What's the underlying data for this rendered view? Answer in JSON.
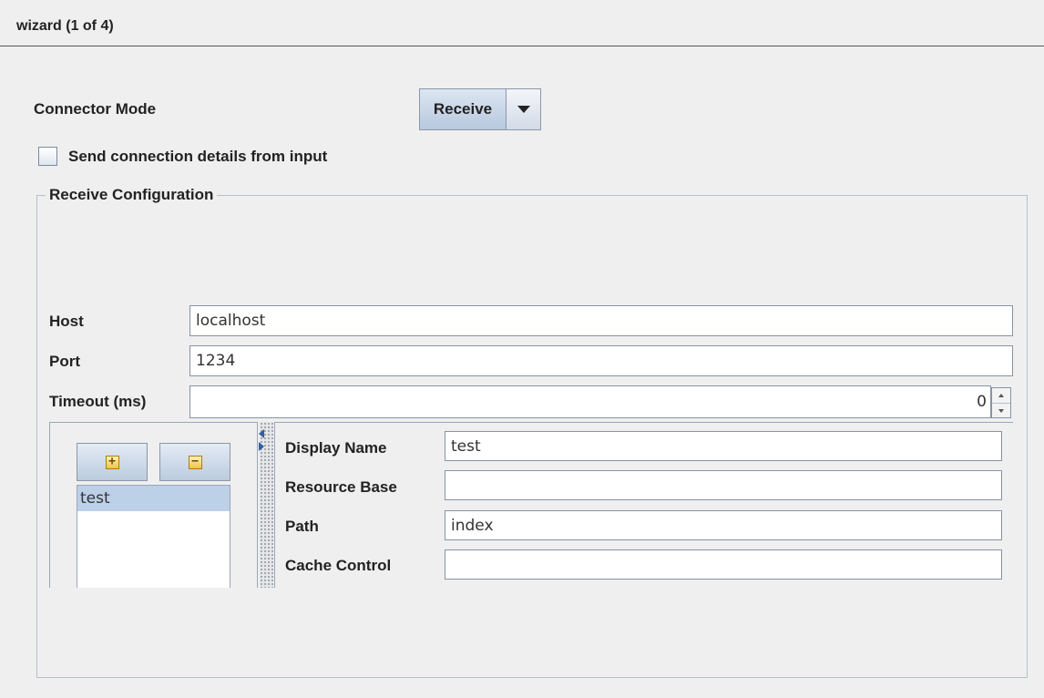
{
  "window": {
    "title": "wizard (1 of 4)"
  },
  "connector_mode": {
    "label": "Connector Mode",
    "selected": "Receive"
  },
  "send_details": {
    "label": "Send connection details from input",
    "checked": false
  },
  "receive_config": {
    "legend": "Receive Configuration",
    "host": {
      "label": "Host",
      "value": "localhost"
    },
    "port": {
      "label": "Port",
      "value": "1234"
    },
    "timeout": {
      "label": "Timeout (ms)",
      "value": "0"
    }
  },
  "resources": {
    "add_icon": "plus-icon",
    "remove_icon": "minus-icon",
    "items": [
      {
        "label": "test",
        "selected": true
      }
    ]
  },
  "resource_detail": {
    "display_name": {
      "label": "Display Name",
      "value": "test"
    },
    "resource_base": {
      "label": "Resource Base",
      "value": ""
    },
    "path": {
      "label": "Path",
      "value": "index"
    },
    "cache_control": {
      "label": "Cache Control",
      "value": ""
    }
  },
  "colors": {
    "selection": "#bcd0e8",
    "border": "#8793a6",
    "background": "#efefef"
  }
}
